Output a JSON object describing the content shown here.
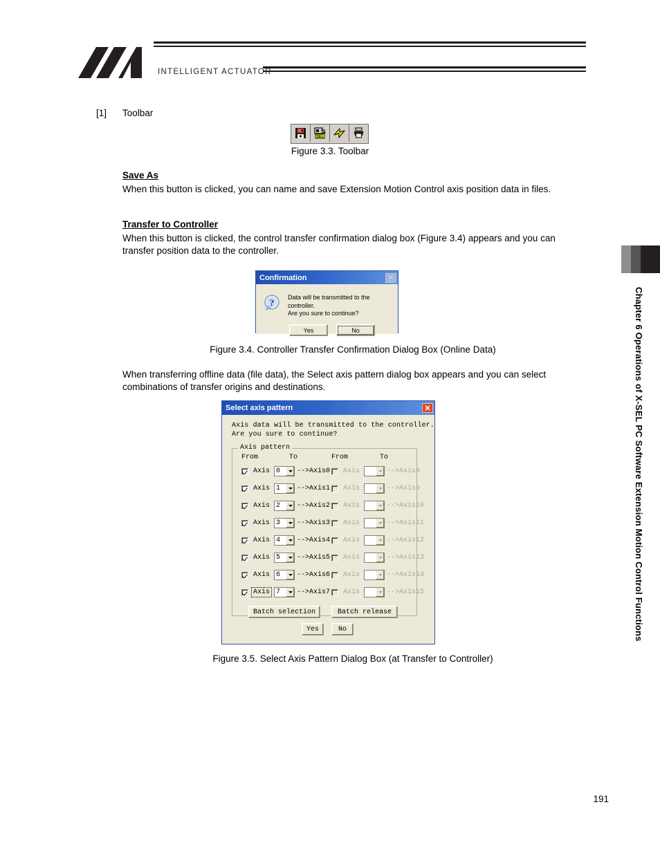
{
  "header": {
    "brand_text": "INTELLIGENT ACTUATOR",
    "logo_name": "ia-logo"
  },
  "content": {
    "item_number": "[1]",
    "item_title": "Toolbar",
    "toolbar_caption": "Figure 3.3. Toolbar",
    "toolbar_buttons": [
      {
        "name": "save-as-icon",
        "label": "Save As"
      },
      {
        "name": "transfer-to-controller-icon",
        "label": "Transfer to Controller"
      },
      {
        "name": "lightning-bolt-icon",
        "label": "Flash"
      },
      {
        "name": "print-icon",
        "label": "Print"
      }
    ],
    "sections": [
      {
        "heading": "Save As",
        "body": "When this button is clicked, you can name and save Extension Motion Control axis position data in files."
      },
      {
        "heading": "Transfer to Controller",
        "body": "When this button is clicked, the control transfer confirmation dialog box (Figure 3.4) appears and you can transfer position data to the controller."
      }
    ],
    "figure_3_4_caption": "Figure 3.4. Controller Transfer Confirmation Dialog Box (Online Data)",
    "offline_paragraph": "When transferring offline data (file data), the Select axis pattern dialog box appears and you can select combinations of transfer origins and destinations.",
    "figure_3_5_caption": "Figure 3.5. Select Axis Pattern Dialog Box (at Transfer to Controller)"
  },
  "confirmation_dialog": {
    "title": "Confirmation",
    "close_label": "×",
    "icon": "question-mark-icon",
    "message": "Data will be transmitted to the controller.\nAre you sure to continue?",
    "yes_label": "Yes",
    "yes_mnemonic": "Y",
    "no_label": "No",
    "no_mnemonic": "N",
    "focused_button": "No",
    "titlebar_color": "#2f64c8"
  },
  "axis_dialog": {
    "title": "Select axis pattern",
    "close_label": "✕",
    "close_color": "#d94a2b",
    "message": "Axis data will be transmitted to the controller.\nAre you sure to continue?",
    "group_legend": "Axis pattern",
    "column_headers": {
      "from_left": "From",
      "to_left": "To",
      "from_right": "From",
      "to_right": "To"
    },
    "rows": [
      {
        "left": {
          "checked": true,
          "enabled": true,
          "label": "Axis",
          "value": "0",
          "dest": "-->Axis0",
          "focused": false
        },
        "right": {
          "checked": false,
          "enabled": false,
          "label": "Axis",
          "value": "",
          "dest": "-->Axis8",
          "focused": false
        }
      },
      {
        "left": {
          "checked": true,
          "enabled": true,
          "label": "Axis",
          "value": "1",
          "dest": "-->Axis1",
          "focused": false
        },
        "right": {
          "checked": false,
          "enabled": false,
          "label": "Axis",
          "value": "",
          "dest": "-->Axis9",
          "focused": false
        }
      },
      {
        "left": {
          "checked": true,
          "enabled": true,
          "label": "Axis",
          "value": "2",
          "dest": "-->Axis2",
          "focused": false
        },
        "right": {
          "checked": false,
          "enabled": false,
          "label": "Axis",
          "value": "",
          "dest": "-->Axis10",
          "focused": false
        }
      },
      {
        "left": {
          "checked": true,
          "enabled": true,
          "label": "Axis",
          "value": "3",
          "dest": "-->Axis3",
          "focused": false
        },
        "right": {
          "checked": false,
          "enabled": false,
          "label": "Axis",
          "value": "",
          "dest": "-->Axis11",
          "focused": false
        }
      },
      {
        "left": {
          "checked": true,
          "enabled": true,
          "label": "Axis",
          "value": "4",
          "dest": "-->Axis4",
          "focused": false
        },
        "right": {
          "checked": false,
          "enabled": false,
          "label": "Axis",
          "value": "",
          "dest": "-->Axis12",
          "focused": false
        }
      },
      {
        "left": {
          "checked": true,
          "enabled": true,
          "label": "Axis",
          "value": "5",
          "dest": "-->Axis5",
          "focused": false
        },
        "right": {
          "checked": false,
          "enabled": false,
          "label": "Axis",
          "value": "",
          "dest": "-->Axis13",
          "focused": false
        }
      },
      {
        "left": {
          "checked": true,
          "enabled": true,
          "label": "Axis",
          "value": "6",
          "dest": "-->Axis6",
          "focused": false
        },
        "right": {
          "checked": false,
          "enabled": false,
          "label": "Axis",
          "value": "",
          "dest": "-->Axis14",
          "focused": false
        }
      },
      {
        "left": {
          "checked": true,
          "enabled": true,
          "label": "Axis",
          "value": "7",
          "dest": "-->Axis7",
          "focused": true
        },
        "right": {
          "checked": false,
          "enabled": false,
          "label": "Axis",
          "value": "",
          "dest": "-->Axis15",
          "focused": false
        }
      }
    ],
    "batch_selection_label": "Batch selection",
    "batch_release_label": "Batch release",
    "yes_label": "Yes",
    "no_label": "No"
  },
  "side": {
    "chapter_text": "Chapter 6 Operations of X-SEL PC Software Extension Motion Control Functions",
    "tab_colors": [
      "#8d8d8d",
      "#555555",
      "#231f20"
    ]
  },
  "footer": {
    "page_number": "191"
  }
}
